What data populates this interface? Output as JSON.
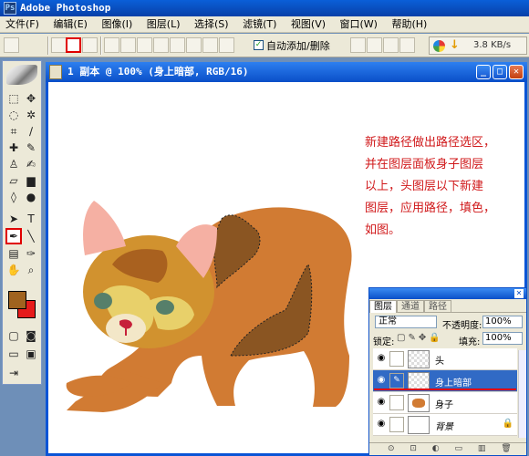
{
  "app": {
    "title": "Adobe Photoshop"
  },
  "menu": [
    "文件(F)",
    "编辑(E)",
    "图像(I)",
    "图层(L)",
    "选择(S)",
    "滤镜(T)",
    "视图(V)",
    "窗口(W)",
    "帮助(H)"
  ],
  "options": {
    "auto_add_delete_label": "自动添加/删除",
    "auto_add_delete_checked": "✓",
    "net_speed": "3.8 KB/s"
  },
  "document": {
    "title": "1 副本 @ 100% (身上暗部, RGB/16)",
    "instruction_lines": [
      "新建路径做出路径选区，",
      "并在图层面板身子图层",
      "以上，头图层以下新建",
      "图层，应用路径，填色，",
      "如图。"
    ]
  },
  "colors": {
    "foreground": "#a0631f",
    "background": "#e61b1b",
    "highlight": "#e00000",
    "selected_layer": "#316ac5"
  },
  "layers_panel": {
    "tabs": [
      "图层",
      "通道",
      "路径"
    ],
    "blend_mode": "正常",
    "opacity_label": "不透明度:",
    "opacity": "100%",
    "lock_label": "锁定:",
    "fill_label": "填充:",
    "fill": "100%",
    "layers": [
      {
        "name": "头",
        "selected": false,
        "icon": "eye-icon"
      },
      {
        "name": "身上暗部",
        "selected": true,
        "icon": "eye-icon"
      },
      {
        "name": "身子",
        "selected": false,
        "icon": "eye-icon"
      },
      {
        "name": "背景",
        "selected": false,
        "icon": "eye-icon",
        "locked": true
      }
    ]
  }
}
